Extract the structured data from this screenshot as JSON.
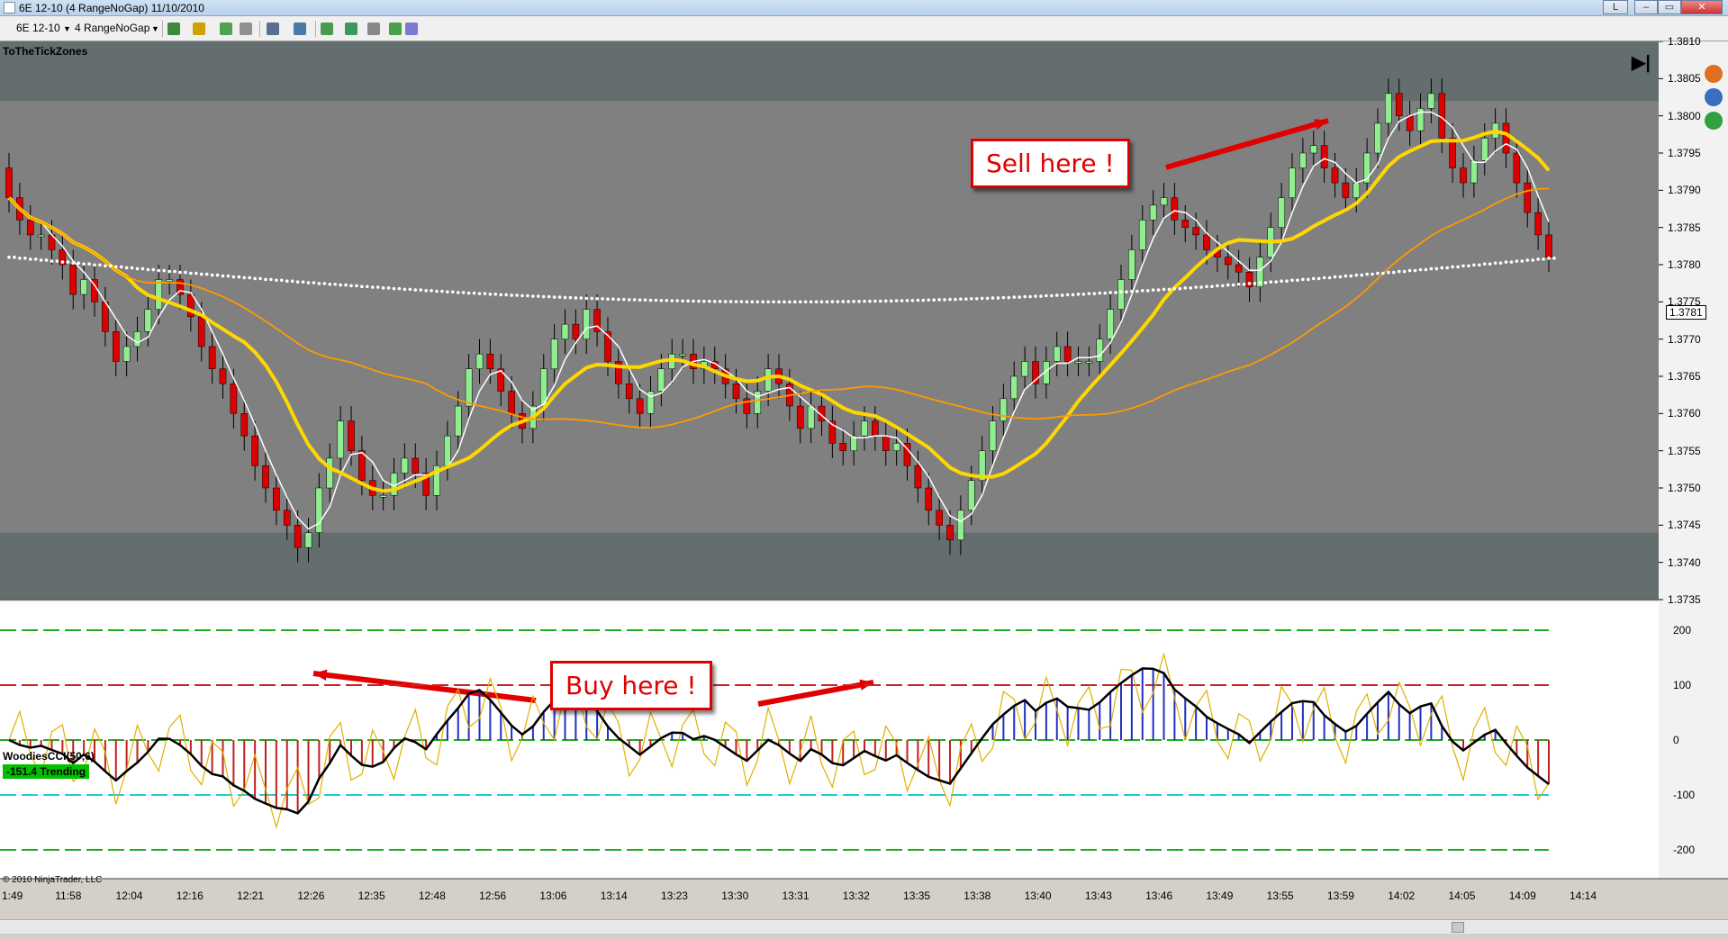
{
  "window": {
    "title": "6E 12-10 (4 RangeNoGap)  11/10/2010",
    "buttons": [
      "L",
      "–",
      "▭",
      "✕"
    ]
  },
  "toolbar": {
    "instrument": "6E 12-10",
    "period": "4 RangeNoGap"
  },
  "chart": {
    "indicator_name": "ToTheTickZones",
    "current_price_label": "1.3781",
    "price_ticks": [
      "1.3810",
      "1.3805",
      "1.3800",
      "1.3795",
      "1.3790",
      "1.3785",
      "1.3780",
      "1.3775",
      "1.3770",
      "1.3765",
      "1.3760",
      "1.3755",
      "1.3750",
      "1.3745",
      "1.3740",
      "1.3735"
    ],
    "callouts": {
      "sell": "Sell here !",
      "buy": "Buy here !"
    },
    "colors": {
      "background": "#808080",
      "zone": "#5f6b6b",
      "bull_candle": "#90ee90",
      "bear_candle": "#dd0000",
      "fast_ma": "#ffffff",
      "slow_ma": "#ffd700",
      "long_ma": "#ff9900",
      "dots": "#ffffff"
    }
  },
  "cci_panel": {
    "name": "WoodiesCCI(50,6)",
    "status": "-151.4 Trending",
    "levels": [
      "200",
      "100",
      "0",
      "-100",
      "-200"
    ],
    "copyright": "© 2010 NinjaTrader, LLC"
  },
  "time_axis": [
    "1:49",
    "11:58",
    "12:04",
    "12:16",
    "12:21",
    "12:26",
    "12:35",
    "12:48",
    "12:56",
    "13:06",
    "13:14",
    "13:23",
    "13:30",
    "13:31",
    "13:32",
    "13:35",
    "13:38",
    "13:40",
    "13:43",
    "13:46",
    "13:49",
    "13:55",
    "13:59",
    "14:02",
    "14:05",
    "14:09",
    "14:14"
  ],
  "chart_data": {
    "type": "candlestick",
    "title": "6E 12-10 (4 RangeNoGap)  11/10/2010",
    "close": [
      1.3789,
      1.3786,
      1.3784,
      1.3784,
      1.3782,
      1.378,
      1.3776,
      1.3778,
      1.3775,
      1.3771,
      1.3767,
      1.3769,
      1.3771,
      1.3774,
      1.3778,
      1.3778,
      1.3776,
      1.3773,
      1.3769,
      1.3766,
      1.3764,
      1.376,
      1.3757,
      1.3753,
      1.375,
      1.3747,
      1.3745,
      1.3742,
      1.3744,
      1.375,
      1.3754,
      1.3759,
      1.3755,
      1.3751,
      1.3749,
      1.3749,
      1.3752,
      1.3754,
      1.3752,
      1.3749,
      1.3753,
      1.3757,
      1.3761,
      1.3766,
      1.3768,
      1.3766,
      1.3763,
      1.376,
      1.3758,
      1.3761,
      1.3766,
      1.377,
      1.3772,
      1.377,
      1.3774,
      1.3771,
      1.3767,
      1.3764,
      1.3762,
      1.376,
      1.3763,
      1.3766,
      1.3768,
      1.3768,
      1.3766,
      1.3767,
      1.3766,
      1.3764,
      1.3762,
      1.376,
      1.3763,
      1.3766,
      1.3764,
      1.3761,
      1.3758,
      1.3761,
      1.3759,
      1.3756,
      1.3755,
      1.3757,
      1.3759,
      1.3757,
      1.3755,
      1.3756,
      1.3753,
      1.375,
      1.3747,
      1.3745,
      1.3743,
      1.3747,
      1.3751,
      1.3755,
      1.3759,
      1.3762,
      1.3765,
      1.3767,
      1.3764,
      1.3767,
      1.3769,
      1.3767,
      1.3767,
      1.3767,
      1.377,
      1.3774,
      1.3778,
      1.3782,
      1.3786,
      1.3788,
      1.3789,
      1.3786,
      1.3785,
      1.3784,
      1.3782,
      1.3781,
      1.378,
      1.3779,
      1.3777,
      1.3781,
      1.3785,
      1.3789,
      1.3793,
      1.3795,
      1.3796,
      1.3793,
      1.3791,
      1.3789,
      1.3791,
      1.3795,
      1.3799,
      1.3803,
      1.38,
      1.3798,
      1.3801,
      1.3803,
      1.3797,
      1.3793,
      1.3791,
      1.3794,
      1.3797,
      1.3799,
      1.3795,
      1.3791,
      1.3787,
      1.3784,
      1.3781
    ],
    "ylim": [
      1.3735,
      1.381
    ],
    "series": [
      {
        "name": "WoodiesCCI(50,6)",
        "last": -151.4
      }
    ]
  }
}
